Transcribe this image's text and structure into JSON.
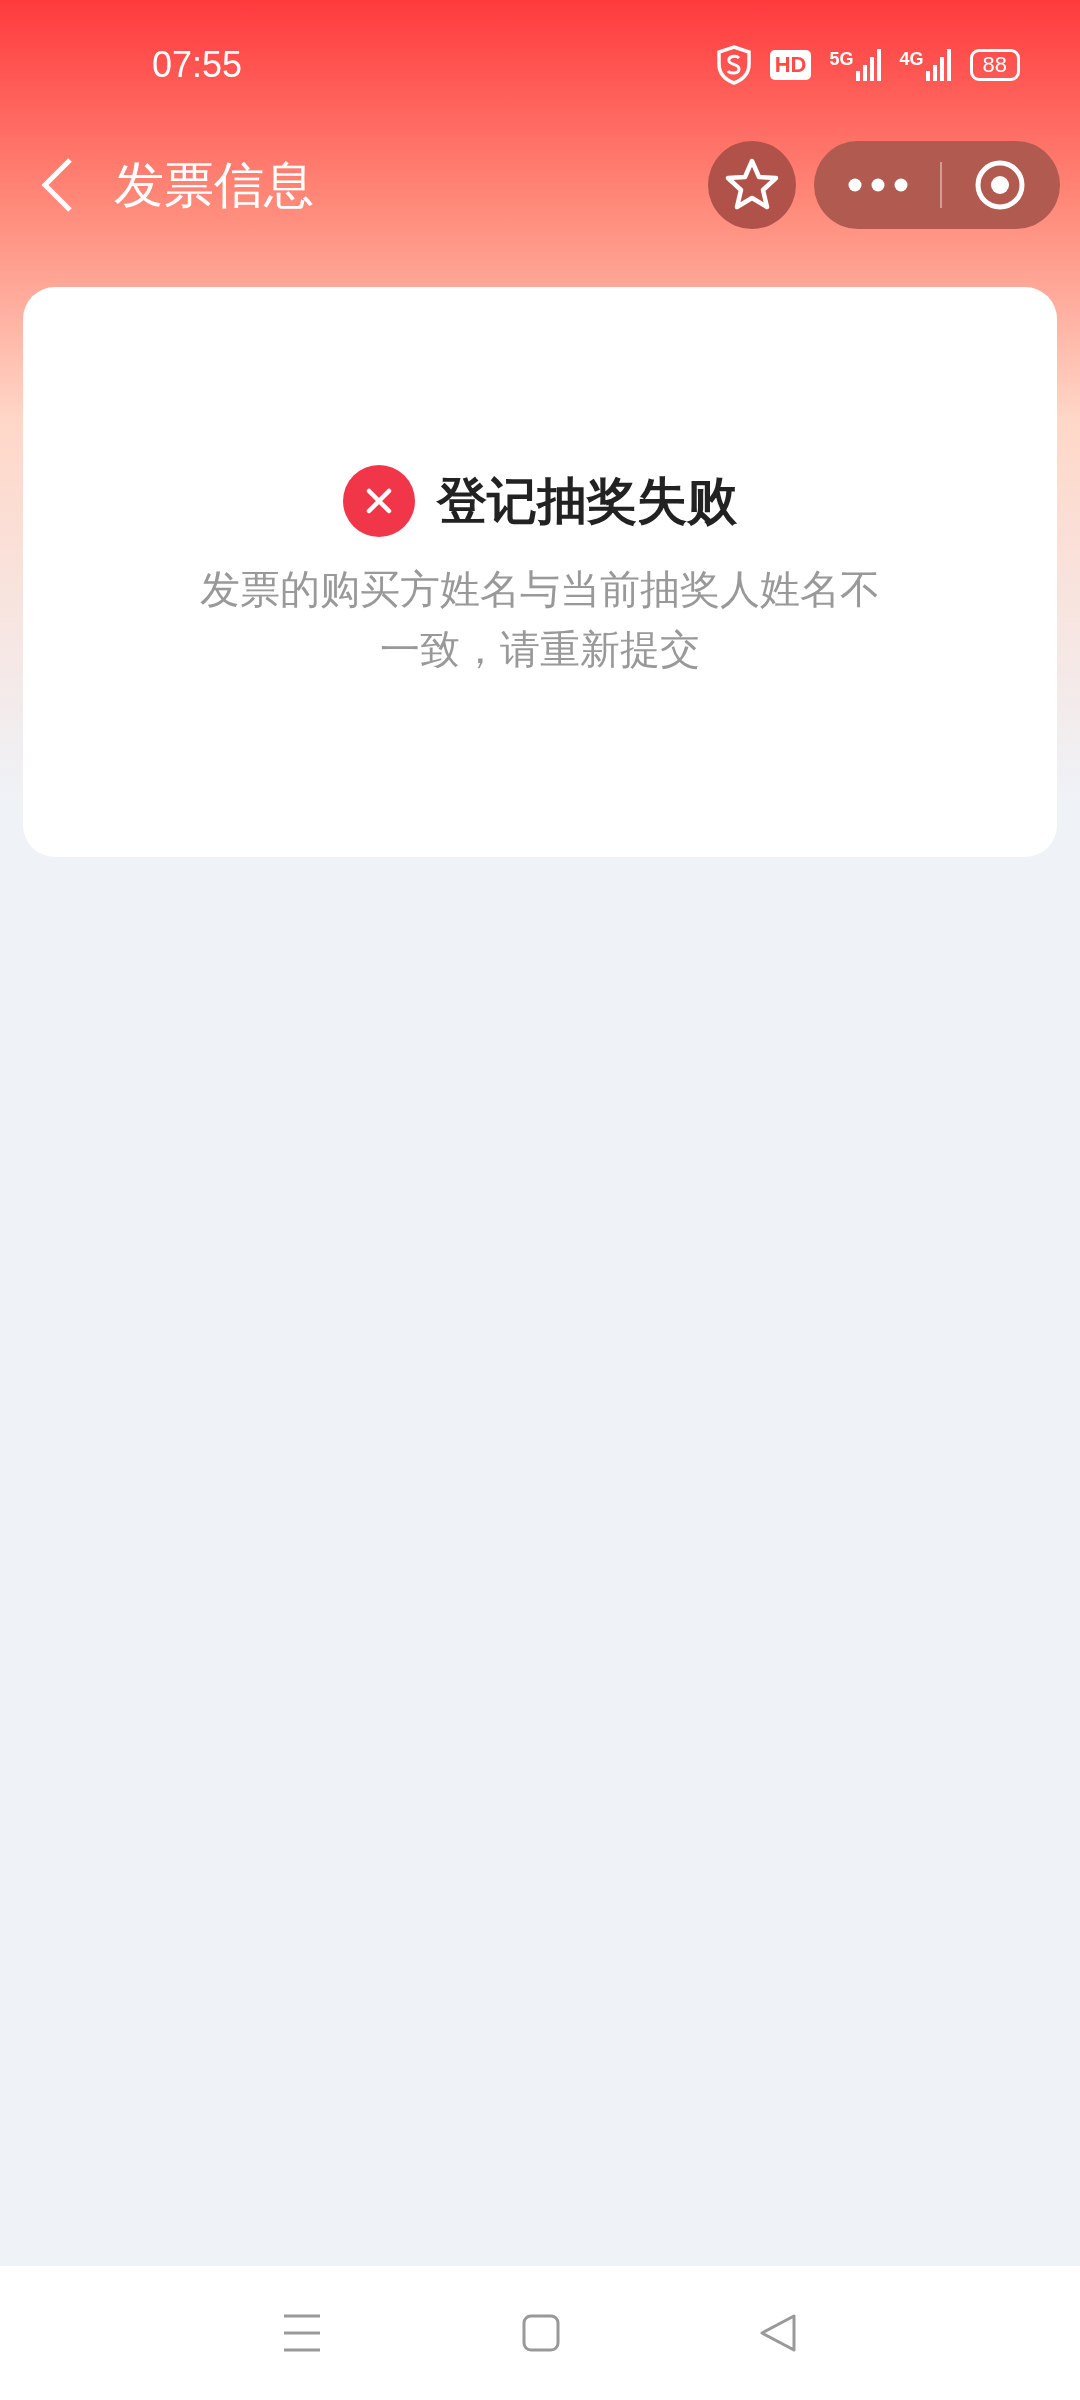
{
  "status_bar": {
    "time": "07:55",
    "hd": "HD",
    "networks": [
      "5G",
      "4G"
    ],
    "battery": "88"
  },
  "header": {
    "title": "发票信息"
  },
  "result": {
    "kind": "error",
    "title": "登记抽奖失败",
    "message": "发票的购买方姓名与当前抽奖人姓名不一致，请重新提交"
  }
}
